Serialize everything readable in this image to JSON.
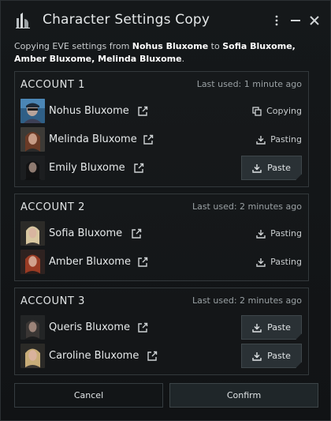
{
  "window": {
    "title": "Character Settings Copy"
  },
  "description": {
    "prefix": "Copying EVE settings from ",
    "source": "Nohus Bluxome",
    "middle": " to ",
    "targets": "Sofia Bluxome, Amber Bluxome, Melinda Bluxome",
    "suffix": "."
  },
  "accounts": [
    {
      "title": "ACCOUNT 1",
      "last_used": "Last used: 1 minute ago",
      "characters": [
        {
          "name": "Nohus Bluxome",
          "status": "Copying",
          "status_icon": "copy-icon"
        },
        {
          "name": "Melinda Bluxome",
          "status": "Pasting",
          "status_icon": "download-icon"
        },
        {
          "name": "Emily Bluxome",
          "button": "Paste",
          "button_icon": "download-icon"
        }
      ]
    },
    {
      "title": "ACCOUNT 2",
      "last_used": "Last used: 2 minutes ago",
      "characters": [
        {
          "name": "Sofia Bluxome",
          "status": "Pasting",
          "status_icon": "download-icon"
        },
        {
          "name": "Amber Bluxome",
          "status": "Pasting",
          "status_icon": "download-icon"
        }
      ]
    },
    {
      "title": "ACCOUNT 3",
      "last_used": "Last used: 2 minutes ago",
      "characters": [
        {
          "name": "Queris Bluxome",
          "button": "Paste",
          "button_icon": "download-icon"
        },
        {
          "name": "Caroline Bluxome",
          "button": "Paste",
          "button_icon": "download-icon"
        }
      ]
    }
  ],
  "footer": {
    "cancel_label": "Cancel",
    "confirm_label": "Confirm"
  },
  "colors": {
    "background": "#121416",
    "panel_border": "#33393c",
    "button_bg": "#2a3135",
    "text": "#e6e9ea"
  }
}
